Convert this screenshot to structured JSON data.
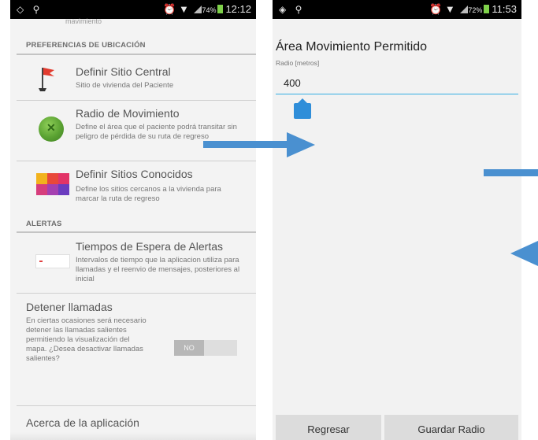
{
  "left_screen": {
    "status": {
      "left_icons": "◇ ⚲",
      "battery": "74%",
      "time": "12:12"
    },
    "cut_text": "mavimiento",
    "location_header": "PREFERENCIAS DE UBICACIÓN",
    "items": [
      {
        "title": "Definir Sitio Central",
        "summary": "Sitio de vivienda del Paciente"
      },
      {
        "title": "Radio de Movimiento",
        "summary": "Define el área que el paciente podrá transitar sin peligro de pérdida de su ruta de regreso"
      },
      {
        "title": "Definir Sitios Conocidos",
        "summary": "Define los sitios cercanos a la vivienda para marcar la ruta de regreso"
      }
    ],
    "alerts_header": "ALERTAS",
    "alert_item": {
      "title": "Tiempos de Espera de Alertas",
      "summary": "Intervalos de tiempo que la aplicacion utiliza para llamadas y el reenvio de mensajes, posteriores al inicial"
    },
    "stop_calls": {
      "title": "Detener llamadas",
      "summary": "En ciertas ocasiones será necesario detener las llamadas salientes permitiendo la visualización del mapa. ¿Desea desactivar llamadas salientes?",
      "toggle_label": "NO"
    },
    "about": "Acerca de la aplicación"
  },
  "right_screen": {
    "status": {
      "left_icons": "◈ ⚲",
      "battery": "72%",
      "time": "11:53"
    },
    "title": "Área Movimiento Permitido",
    "input_label": "Radio [metros]",
    "input_value": "400",
    "buttons": {
      "back": "Regresar",
      "save": "Guardar Radio"
    }
  },
  "colors": {
    "accent": "#34aee3",
    "arrow": "#4a90d0",
    "status_bar": "#000000"
  },
  "icons": [
    "flag-icon",
    "globe-icon",
    "color-grid-icon",
    "alert-timer-icon",
    "text-handle-icon"
  ]
}
